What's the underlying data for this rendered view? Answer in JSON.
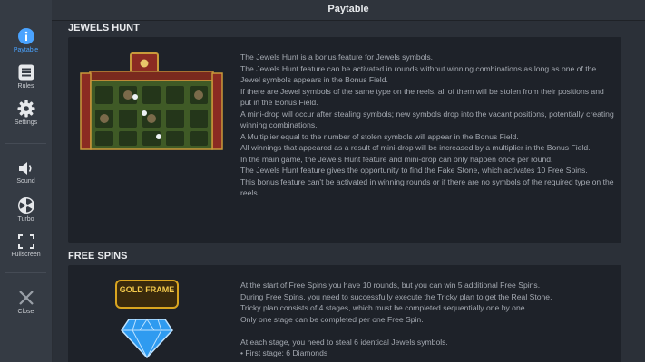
{
  "app": {
    "title": "Paytable"
  },
  "sidebar": {
    "items": [
      {
        "label": "Paytable",
        "icon": "info-icon",
        "active": true
      },
      {
        "label": "Rules",
        "icon": "rules-icon"
      },
      {
        "label": "Settings",
        "icon": "gear-icon"
      },
      {
        "label": "Sound",
        "icon": "speaker-icon"
      },
      {
        "label": "Turbo",
        "icon": "turbo-icon"
      },
      {
        "label": "Fullscreen",
        "icon": "fullscreen-icon"
      },
      {
        "label": "Close",
        "icon": "close-icon"
      }
    ]
  },
  "sections": {
    "jewels_hunt": {
      "heading": "JEWELS HUNT",
      "paragraphs": [
        "The Jewels Hunt is a bonus feature for Jewels symbols.",
        "The Jewels Hunt feature can be activated in rounds without winning combinations as long as one of the Jewel symbols appears in the Bonus Field.",
        "If there are Jewel symbols of the same type on the reels, all of them will be stolen from their positions and put in the Bonus Field.",
        "A mini-drop will occur after stealing symbols; new symbols drop into the vacant positions, potentially creating winning combinations.",
        "A Multiplier equal to the number of stolen symbols will appear in the Bonus Field.",
        "All winnings that appeared as a result of mini-drop will be increased by a multiplier in the Bonus Field.",
        "In the main game, the Jewels Hunt feature and mini-drop can only happen once per round.",
        "The Jewels Hunt feature gives the opportunity to find the Fake Stone, which activates 10 Free Spins.",
        "This bonus feature can't be activated in winning rounds or if there are no symbols of the required type on the reels."
      ]
    },
    "free_spins": {
      "heading": "FREE SPINS",
      "logo_text": "GOLD FRAME",
      "paragraphs": [
        "At the start of Free Spins you have 10 rounds, but you can win 5 additional Free Spins.",
        "During Free Spins, you need to successfully execute the Tricky plan to get the Real Stone.",
        "Tricky plan consists of 4 stages, which must be completed sequentially one by one.",
        "Only one stage can be completed per one Free Spin."
      ],
      "paragraphs_2": [
        "At each stage, you need to steal 6 identical Jewels symbols.",
        "• First stage: 6 Diamonds"
      ]
    }
  },
  "colors": {
    "accent": "#4aa3ff",
    "background": "#2b3038",
    "panel": "#1e2229",
    "gold": "#d9a520"
  }
}
